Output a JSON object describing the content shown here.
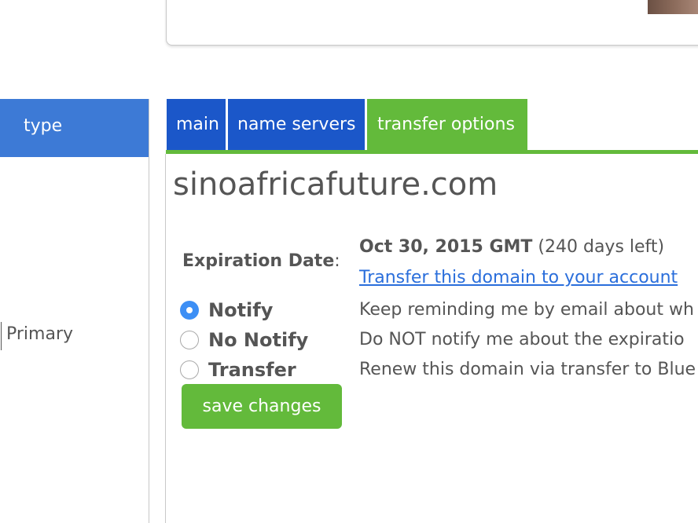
{
  "sidebar": {
    "header_label": "type",
    "row_value": "Primary"
  },
  "tabs": [
    {
      "label": "main"
    },
    {
      "label": "name servers"
    },
    {
      "label": "transfer options"
    }
  ],
  "domain": {
    "name": "sinoafricafuture.com"
  },
  "expiration": {
    "label": "Expiration Date",
    "colon": ":",
    "date": "Oct 30, 2015 GMT",
    "days_left": "(240 days left)",
    "transfer_link": "Transfer this domain to your account"
  },
  "options": [
    {
      "label": "Notify",
      "description": "Keep reminding me by email about wh",
      "checked": true
    },
    {
      "label": "No Notify",
      "description": "Do NOT notify me about the expiratio",
      "checked": false
    },
    {
      "label": "Transfer",
      "description": "Renew this domain via transfer to Blue",
      "checked": false
    }
  ],
  "actions": {
    "save_label": "save changes"
  },
  "colors": {
    "tab_blue": "#1b57c9",
    "tab_green": "#63ba3b",
    "sidebar_header": "#3d7ad6",
    "link": "#2a6edb",
    "radio_checked": "#3d8ff5",
    "text": "#555555"
  }
}
